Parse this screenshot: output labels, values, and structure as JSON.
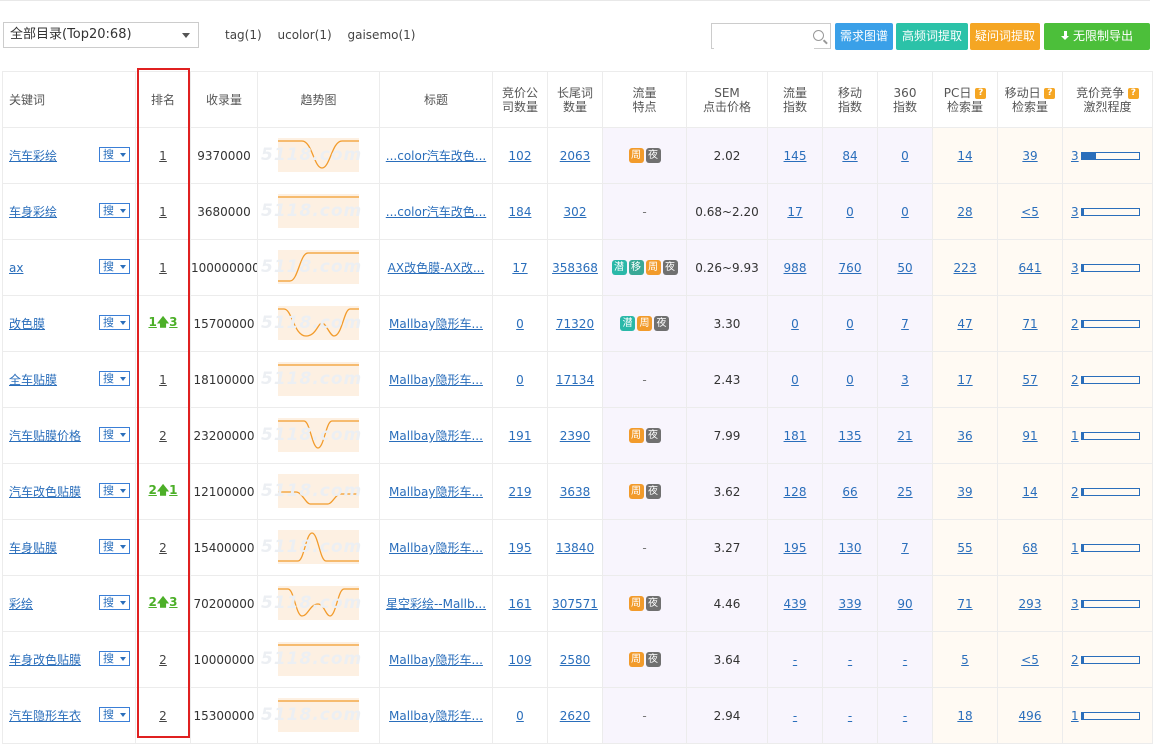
{
  "toolbar": {
    "catalog_select": "全部目录(Top20:68)",
    "tags": [
      "tag(1)",
      "ucolor(1)",
      "gaisemo(1)"
    ],
    "search_placeholder": "",
    "buttons": {
      "demand_map": "需求图谱",
      "high_freq": "高频词提取",
      "question_words": "疑问词提取",
      "export": "无限制导出"
    },
    "colors": {
      "demand_map": "#3aa0e8",
      "high_freq": "#2bc2a8",
      "question_words": "#f5a623",
      "export": "#4cbf3a"
    }
  },
  "table": {
    "headers": {
      "keyword": "关键词",
      "rank": "排名",
      "indexed": "收录量",
      "trend": "趋势图",
      "title": "标题",
      "bid_companies": [
        "竞价公",
        "司数量"
      ],
      "long_tail": [
        "长尾词",
        "数量"
      ],
      "traffic_feature": [
        "流量",
        "特点"
      ],
      "sem_price": [
        "SEM",
        "点击价格"
      ],
      "traffic_index": [
        "流量",
        "指数"
      ],
      "mobile_index": [
        "移动",
        "指数"
      ],
      "index_360": [
        "360",
        "指数"
      ],
      "pc_daily": [
        "PC日",
        "检索量"
      ],
      "mobile_daily": [
        "移动日",
        "检索量"
      ],
      "competition": [
        "竞价竞争",
        "激烈程度"
      ]
    },
    "search_label": "搜",
    "watermark": "5118.com",
    "rows": [
      {
        "keyword": "汽车彩绘",
        "rank": "1",
        "rank_up": "",
        "indexed": "9370000",
        "title": "...color汽车改色...",
        "bid": "102",
        "long_tail": "2063",
        "badges": [
          "周",
          "夜"
        ],
        "sem": "2.02",
        "traffic": "145",
        "mobile": "84",
        "i360": "0",
        "pc": "14",
        "mobile_daily": "39",
        "comp": "3",
        "comp_level": 0.25
      },
      {
        "keyword": "车身彩绘",
        "rank": "1",
        "rank_up": "",
        "indexed": "3680000",
        "title": "...color汽车改色...",
        "bid": "184",
        "long_tail": "302",
        "badges": [],
        "sem": "0.68~2.20",
        "traffic": "17",
        "mobile": "0",
        "i360": "0",
        "pc": "28",
        "mobile_daily": "<5",
        "comp": "3",
        "comp_level": 0.05
      },
      {
        "keyword": "ax",
        "rank": "1",
        "rank_up": "",
        "indexed": "100000000",
        "title": "AX改色膜-AX改...",
        "bid": "17",
        "long_tail": "358368",
        "badges": [
          "潜",
          "移",
          "周",
          "夜"
        ],
        "sem": "0.26~9.93",
        "traffic": "988",
        "mobile": "760",
        "i360": "50",
        "pc": "223",
        "mobile_daily": "641",
        "comp": "3",
        "comp_level": 0.05
      },
      {
        "keyword": "改色膜",
        "rank": "1",
        "rank_up": "3",
        "indexed": "15700000",
        "title": "Mallbay隐形车...",
        "bid": "0",
        "long_tail": "71320",
        "badges": [
          "潜",
          "周",
          "夜"
        ],
        "sem": "3.30",
        "traffic": "0",
        "mobile": "0",
        "i360": "7",
        "pc": "47",
        "mobile_daily": "71",
        "comp": "2",
        "comp_level": 0.05
      },
      {
        "keyword": "全车贴膜",
        "rank": "1",
        "rank_up": "",
        "indexed": "18100000",
        "title": "Mallbay隐形车...",
        "bid": "0",
        "long_tail": "17134",
        "badges": [],
        "sem": "2.43",
        "traffic": "0",
        "mobile": "0",
        "i360": "3",
        "pc": "17",
        "mobile_daily": "57",
        "comp": "2",
        "comp_level": 0.05
      },
      {
        "keyword": "汽车贴膜价格",
        "rank": "2",
        "rank_up": "",
        "indexed": "23200000",
        "title": "Mallbay隐形车...",
        "bid": "191",
        "long_tail": "2390",
        "badges": [
          "周",
          "夜"
        ],
        "sem": "7.99",
        "traffic": "181",
        "mobile": "135",
        "i360": "21",
        "pc": "36",
        "mobile_daily": "91",
        "comp": "1",
        "comp_level": 0.05
      },
      {
        "keyword": "汽车改色贴膜",
        "rank": "2",
        "rank_up": "1",
        "indexed": "12100000",
        "title": "Mallbay隐形车...",
        "bid": "219",
        "long_tail": "3638",
        "badges": [
          "周",
          "夜"
        ],
        "sem": "3.62",
        "traffic": "128",
        "mobile": "66",
        "i360": "25",
        "pc": "39",
        "mobile_daily": "14",
        "comp": "2",
        "comp_level": 0.05
      },
      {
        "keyword": "车身贴膜",
        "rank": "2",
        "rank_up": "",
        "indexed": "15400000",
        "title": "Mallbay隐形车...",
        "bid": "195",
        "long_tail": "13840",
        "badges": [],
        "sem": "3.27",
        "traffic": "195",
        "mobile": "130",
        "i360": "7",
        "pc": "55",
        "mobile_daily": "68",
        "comp": "1",
        "comp_level": 0.05
      },
      {
        "keyword": "彩绘",
        "rank": "2",
        "rank_up": "3",
        "indexed": "70200000",
        "title": "星空彩绘--Mallb...",
        "bid": "161",
        "long_tail": "307571",
        "badges": [
          "周",
          "夜"
        ],
        "sem": "4.46",
        "traffic": "439",
        "mobile": "339",
        "i360": "90",
        "pc": "71",
        "mobile_daily": "293",
        "comp": "3",
        "comp_level": 0.05
      },
      {
        "keyword": "车身改色贴膜",
        "rank": "2",
        "rank_up": "",
        "indexed": "10000000",
        "title": "Mallbay隐形车...",
        "bid": "109",
        "long_tail": "2580",
        "badges": [
          "周",
          "夜"
        ],
        "sem": "3.64",
        "traffic": "-",
        "mobile": "-",
        "i360": "-",
        "pc": "5",
        "mobile_daily": "<5",
        "comp": "2",
        "comp_level": 0.05
      },
      {
        "keyword": "汽车隐形车衣",
        "rank": "2",
        "rank_up": "",
        "indexed": "15300000",
        "title": "Mallbay隐形车...",
        "bid": "0",
        "long_tail": "2620",
        "badges": [],
        "sem": "2.94",
        "traffic": "-",
        "mobile": "-",
        "i360": "-",
        "pc": "18",
        "mobile_daily": "496",
        "comp": "1",
        "comp_level": 0.05
      }
    ]
  }
}
